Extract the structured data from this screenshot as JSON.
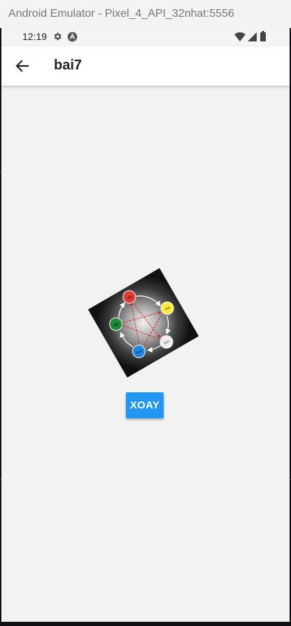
{
  "emulator": {
    "title": "Android Emulator - Pixel_4_API_32nhat:5556"
  },
  "status_bar": {
    "time": "12:19"
  },
  "app_bar": {
    "title": "bai7"
  },
  "main": {
    "image": {
      "description_icon": "five-elements-cycle-diagram",
      "nodes": [
        {
          "label": "Hỏa",
          "color": "#e53935"
        },
        {
          "label": "Thổ",
          "color": "#ffeb3b"
        },
        {
          "label": "Kim",
          "color": "#eeeeee"
        },
        {
          "label": "Thủy",
          "color": "#1e88e5"
        },
        {
          "label": "Mộc",
          "color": "#1b8a3a"
        }
      ]
    },
    "rotate_button": {
      "label": "XOAY"
    }
  },
  "colors": {
    "accent": "#2196f3",
    "app_bar": "#ffffff",
    "background": "#f2f2f2"
  }
}
